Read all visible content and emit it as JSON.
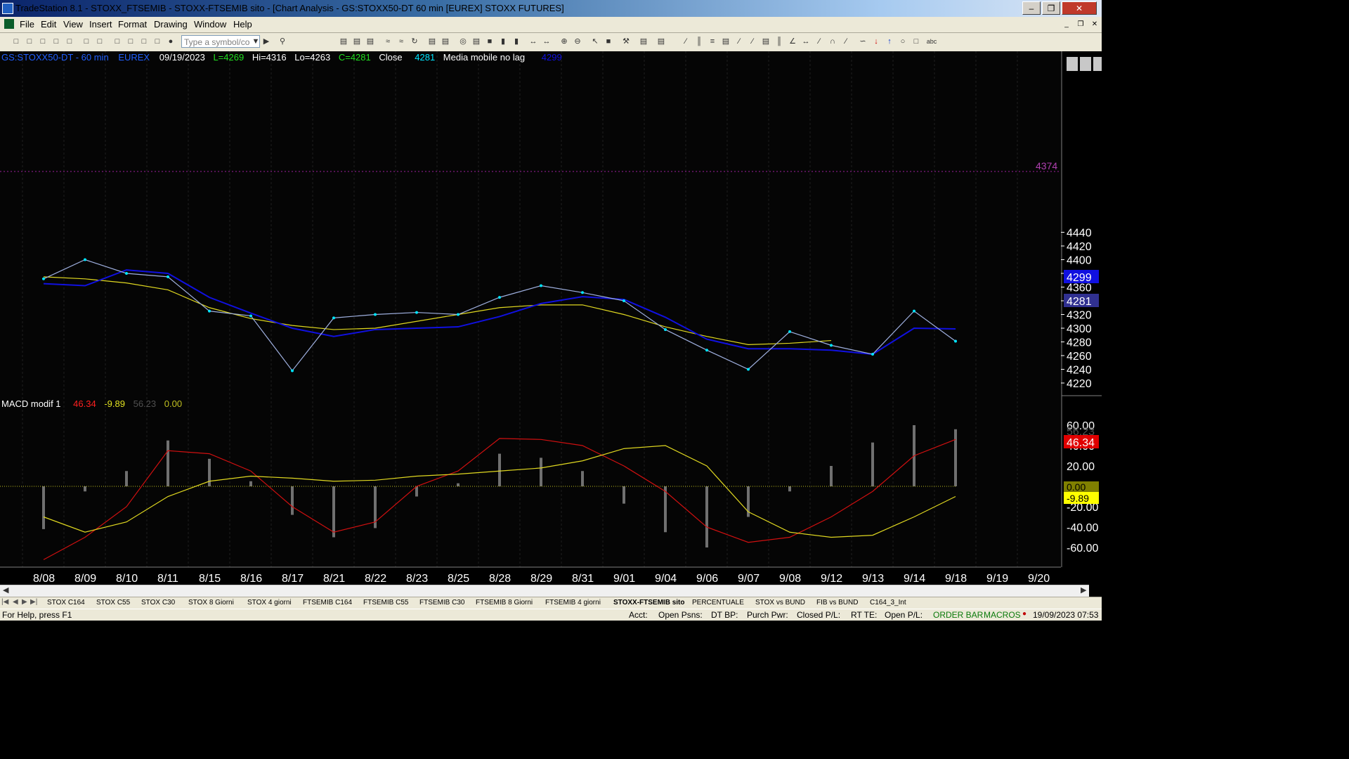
{
  "window": {
    "title": "TradeStation 8.1 - STOXX_FTSEMIB - STOXX-FTSEMIB sito - [Chart Analysis - GS:STOXX50-DT  60 min  [EUREX] STOXX FUTURES]"
  },
  "menu": [
    "File",
    "Edit",
    "View",
    "Insert",
    "Format",
    "Drawing",
    "Window",
    "Help"
  ],
  "toolbar": {
    "symbol_placeholder": "Type a symbol/co"
  },
  "price_panel": {
    "header": {
      "symbol": "GS:STOXX50-DT - 60 min",
      "exchange": "EUREX",
      "date": "09/19/2023",
      "last": "L=4269",
      "high": "Hi=4316",
      "low": "Lo=4263",
      "close": "C=4281",
      "close_label": "Close",
      "close_value": "4281",
      "indicator_name": "Media mobile no lag",
      "indicator_value": "4299"
    },
    "axis_labels": [
      "4440",
      "4420",
      "4400",
      "4380",
      "4360",
      "4340",
      "4320",
      "4300",
      "4280",
      "4260",
      "4240",
      "4220"
    ],
    "reference_line": "4374",
    "badges": {
      "blue": "4299",
      "current": "4281"
    }
  },
  "macd_panel": {
    "header": {
      "name": "MACD modif 1",
      "v1": "46.34",
      "v2": "-9.89",
      "v3": "56.23",
      "v4": "0.00"
    },
    "axis_labels": [
      "60.00",
      "40.00",
      "20.00",
      "0.00",
      "-20.00",
      "-40.00",
      "-60.00"
    ],
    "badges": {
      "hist": "56.23",
      "macd": "46.34",
      "zero": "0.00",
      "signal": "-9.89"
    }
  },
  "date_labels": [
    "8/08",
    "8/09",
    "8/10",
    "8/11",
    "8/15",
    "8/16",
    "8/17",
    "8/21",
    "8/22",
    "8/23",
    "8/25",
    "8/28",
    "8/29",
    "8/31",
    "9/01",
    "9/04",
    "9/06",
    "9/07",
    "9/08",
    "9/12",
    "9/13",
    "9/14",
    "9/18",
    "9/19",
    "9/20"
  ],
  "tabs": [
    "STOX C164",
    "STOX C55",
    "STOX  C30",
    "STOX  8 Giorni",
    "STOX 4 giorni",
    "FTSEMIB C164",
    "FTSEMIB C55",
    "FTSEMIB C30",
    "FTSEMIB  8 Giorni",
    "FTSEMIB  4 giorni",
    "STOXX-FTSEMIB sito",
    "PERCENTUALE",
    "STOX vs BUND",
    "FIB vs BUND",
    "C164_3_Int"
  ],
  "status": {
    "help": "For Help, press F1",
    "acct": "Acct:",
    "open_psns": "Open Psns:",
    "dt_bp": "DT BP:",
    "purch_pwr": "Purch Pwr:",
    "closed_pl": "Closed P/L:",
    "rt_te": "RT TE:",
    "open_pl": "Open P/L:",
    "order_bar": "ORDER BAR",
    "macros": "MACROS",
    "datetime": "19/09/2023 07:53"
  },
  "colors": {
    "price_line": "#9fb0e0",
    "price_dots": "#00e5ff",
    "fast_ma": "#1010e0",
    "slow_ma": "#e0d820",
    "macd_line": "#d01010",
    "signal_line": "#e0d820",
    "hist": "#707070"
  },
  "chart_data": [
    {
      "type": "line",
      "title": "GS:STOXX50-DT - 60 min",
      "x": [
        "8/08",
        "8/09",
        "8/10",
        "8/11",
        "8/15",
        "8/16",
        "8/17",
        "8/21",
        "8/22",
        "8/23",
        "8/25",
        "8/28",
        "8/29",
        "8/31",
        "9/01",
        "9/04",
        "9/06",
        "9/07",
        "9/08",
        "9/12",
        "9/13",
        "9/14",
        "9/18"
      ],
      "ylim": [
        4210,
        4450
      ],
      "series": [
        {
          "name": "Close",
          "values": [
            4372,
            4400,
            4380,
            4375,
            4325,
            4318,
            4238,
            4315,
            4320,
            4323,
            4320,
            4345,
            4362,
            4352,
            4340,
            4298,
            4268,
            4240,
            4295,
            4275,
            4262,
            4325,
            4281
          ]
        },
        {
          "name": "Media mobile no lag",
          "values": [
            4365,
            4362,
            4385,
            4380,
            4345,
            4322,
            4300,
            4288,
            4298,
            4300,
            4302,
            4317,
            4336,
            4346,
            4342,
            4316,
            4284,
            4270,
            4270,
            4268,
            4262,
            4300,
            4299
          ]
        },
        {
          "values": [
            4375,
            4372,
            4366,
            4356,
            4330,
            4314,
            4304,
            4298,
            4300,
            4310,
            4320,
            4330,
            4334,
            4334,
            4320,
            4302,
            4288,
            4276,
            4278,
            4282
          ]
        }
      ]
    },
    {
      "type": "line",
      "title": "MACD modif 1",
      "x": [
        "8/08",
        "8/09",
        "8/10",
        "8/11",
        "8/15",
        "8/16",
        "8/17",
        "8/21",
        "8/22",
        "8/23",
        "8/25",
        "8/28",
        "8/29",
        "8/31",
        "9/01",
        "9/04",
        "9/06",
        "9/07",
        "9/08",
        "9/12",
        "9/13",
        "9/14",
        "9/18"
      ],
      "ylim": [
        -75,
        75
      ],
      "series": [
        {
          "values": [
            -72,
            -50,
            -20,
            35,
            32,
            15,
            -20,
            -45,
            -35,
            0,
            15,
            47,
            46,
            40,
            20,
            -5,
            -40,
            -55,
            -50,
            -30,
            -5,
            30,
            46
          ]
        },
        {
          "values": [
            -30,
            -45,
            -35,
            -10,
            5,
            10,
            8,
            5,
            6,
            10,
            12,
            15,
            18,
            25,
            37,
            40,
            20,
            -25,
            -45,
            -50,
            -48,
            -30,
            -10
          ]
        },
        {
          "values": [
            -42,
            -5,
            15,
            45,
            27,
            5,
            -28,
            -50,
            -41,
            -10,
            3,
            32,
            28,
            15,
            -17,
            -45,
            -60,
            -30,
            -5,
            20,
            43,
            60,
            56
          ]
        }
      ]
    }
  ]
}
